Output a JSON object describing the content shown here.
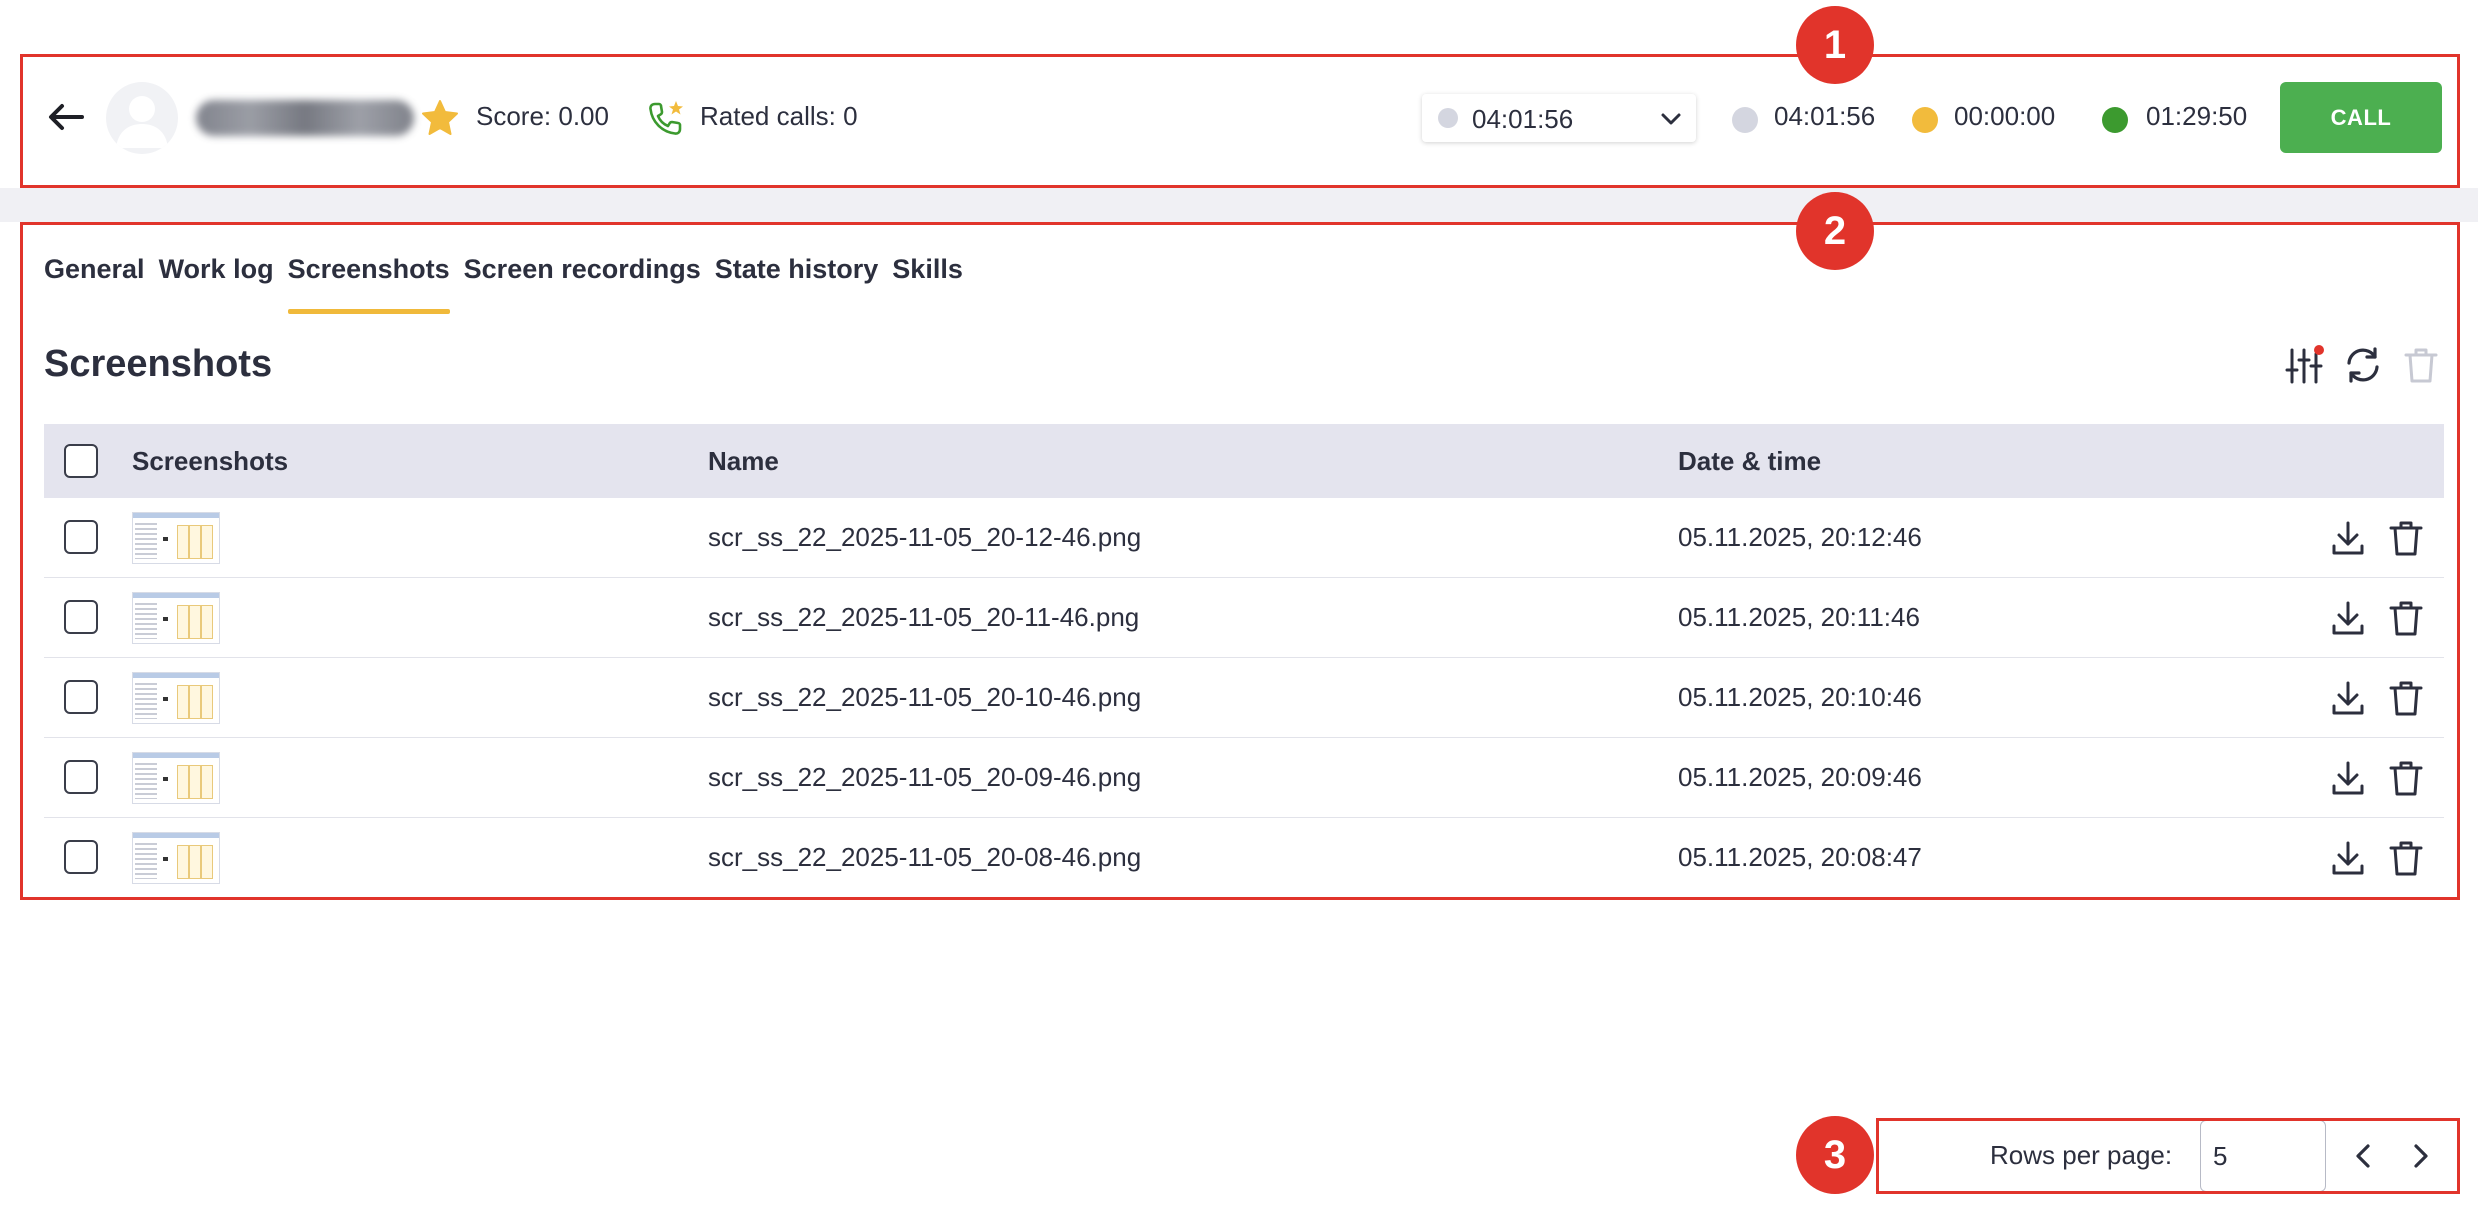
{
  "header": {
    "score": "Score: 0.00",
    "rated_calls": "Rated calls: 0",
    "state_select_value": "04:01:56",
    "timers": [
      {
        "value": "04:01:56",
        "color": "#d4d6e0"
      },
      {
        "value": "00:00:00",
        "color": "#f2bb3c"
      },
      {
        "value": "01:29:50",
        "color": "#3c9a2f"
      }
    ],
    "call_label": "CALL"
  },
  "tabs": [
    "General",
    "Work log",
    "Screenshots",
    "Screen recordings",
    "State history",
    "Skills"
  ],
  "active_tab": "Screenshots",
  "section_title": "Screenshots",
  "table": {
    "columns": [
      "Screenshots",
      "Name",
      "Date & time"
    ],
    "rows": [
      {
        "name": "scr_ss_22_2025-11-05_20-12-46.png",
        "datetime": "05.11.2025, 20:12:46"
      },
      {
        "name": "scr_ss_22_2025-11-05_20-11-46.png",
        "datetime": "05.11.2025, 20:11:46"
      },
      {
        "name": "scr_ss_22_2025-11-05_20-10-46.png",
        "datetime": "05.11.2025, 20:10:46"
      },
      {
        "name": "scr_ss_22_2025-11-05_20-09-46.png",
        "datetime": "05.11.2025, 20:09:46"
      },
      {
        "name": "scr_ss_22_2025-11-05_20-08-46.png",
        "datetime": "05.11.2025, 20:08:47"
      }
    ]
  },
  "pagination": {
    "rows_per_page_label": "Rows per page:",
    "rows_per_page_value": "5"
  },
  "annotations": [
    "1",
    "2",
    "3"
  ],
  "colors": {
    "accent_tab": "#f0b93a",
    "call_green": "#4caf50",
    "annotation_red": "#e1342b",
    "star": "#f2bb3c"
  },
  "icons": {
    "back": "arrow-left-icon",
    "star": "star-icon",
    "phone": "phone-star-icon",
    "filter": "filter-sliders-icon",
    "refresh": "refresh-icon",
    "delete_all": "trash-icon",
    "download": "download-icon",
    "delete": "trash-icon",
    "prev": "chevron-left-icon",
    "next": "chevron-right-icon"
  }
}
